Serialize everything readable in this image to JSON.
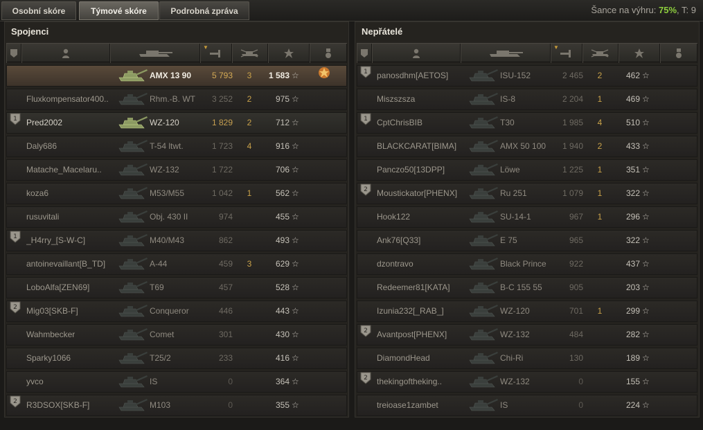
{
  "tabs": [
    {
      "label": "Osobní skóre"
    },
    {
      "label": "Týmové skóre"
    },
    {
      "label": "Podrobná zpráva"
    }
  ],
  "win_chance": {
    "label": "Šance na výhru:",
    "value": "75%",
    "tier": "T: 9"
  },
  "colors": {
    "accent_green": "#8ecf3e",
    "gold": "#c9a24a"
  },
  "allies": {
    "title": "Spojenci",
    "rows": [
      {
        "badge": "",
        "name": "",
        "vehicle": "AMX 13 90",
        "damage": "5 793",
        "kills": "3",
        "xp": "1 583",
        "award": "medal-icon",
        "style": "player"
      },
      {
        "badge": "",
        "name": "Fluxkompensator400..",
        "vehicle": "Rhm.-B. WT",
        "damage": "3 252",
        "kills": "2",
        "xp": "975",
        "award": "",
        "style": ""
      },
      {
        "badge": "platoon-1",
        "name": "Pred2002",
        "vehicle": "WZ-120",
        "damage": "1 829",
        "kills": "2",
        "xp": "712",
        "award": "",
        "style": "platoon"
      },
      {
        "badge": "",
        "name": "Daly686",
        "vehicle": "T-54 ltwt.",
        "damage": "1 723",
        "kills": "4",
        "xp": "916",
        "award": "",
        "style": ""
      },
      {
        "badge": "",
        "name": "Matache_Macelaru..",
        "vehicle": "WZ-132",
        "damage": "1 722",
        "kills": "",
        "xp": "706",
        "award": "",
        "style": ""
      },
      {
        "badge": "",
        "name": "koza6",
        "vehicle": "M53/M55",
        "damage": "1 042",
        "kills": "1",
        "xp": "562",
        "award": "",
        "style": ""
      },
      {
        "badge": "",
        "name": "rusuvitali",
        "vehicle": "Obj. 430 II",
        "damage": "974",
        "kills": "",
        "xp": "455",
        "award": "",
        "style": ""
      },
      {
        "badge": "platoon-1",
        "name": "_H4rry_[S-W-C]",
        "vehicle": "M40/M43",
        "damage": "862",
        "kills": "",
        "xp": "493",
        "award": "",
        "style": ""
      },
      {
        "badge": "",
        "name": "antoinevaillant[B_TD]",
        "vehicle": "A-44",
        "damage": "459",
        "kills": "3",
        "xp": "629",
        "award": "",
        "style": ""
      },
      {
        "badge": "",
        "name": "LoboAlfa[ZEN69]",
        "vehicle": "T69",
        "damage": "457",
        "kills": "",
        "xp": "528",
        "award": "",
        "style": ""
      },
      {
        "badge": "platoon-2",
        "name": "Mig03[SKB-F]",
        "vehicle": "Conqueror",
        "damage": "446",
        "kills": "",
        "xp": "443",
        "award": "",
        "style": ""
      },
      {
        "badge": "",
        "name": "Wahmbecker",
        "vehicle": "Comet",
        "damage": "301",
        "kills": "",
        "xp": "430",
        "award": "",
        "style": ""
      },
      {
        "badge": "",
        "name": "Sparky1066",
        "vehicle": "T25/2",
        "damage": "233",
        "kills": "",
        "xp": "416",
        "award": "",
        "style": ""
      },
      {
        "badge": "",
        "name": "yvco",
        "vehicle": "IS",
        "damage": "0",
        "kills": "",
        "xp": "364",
        "award": "",
        "style": "dim"
      },
      {
        "badge": "platoon-2",
        "name": "R3DSOX[SKB-F]",
        "vehicle": "M103",
        "damage": "0",
        "kills": "",
        "xp": "355",
        "award": "",
        "style": "dim"
      }
    ]
  },
  "enemies": {
    "title": "Nepřátelé",
    "rows": [
      {
        "badge": "platoon-1",
        "name": "panosdhm[AETOS]",
        "vehicle": "ISU-152",
        "damage": "2 465",
        "kills": "2",
        "xp": "462",
        "award": "",
        "style": ""
      },
      {
        "badge": "",
        "name": "Miszszsza",
        "vehicle": "IS-8",
        "damage": "2 204",
        "kills": "1",
        "xp": "469",
        "award": "",
        "style": ""
      },
      {
        "badge": "platoon-1",
        "name": "CptChrisBIB",
        "vehicle": "T30",
        "damage": "1 985",
        "kills": "4",
        "xp": "510",
        "award": "",
        "style": ""
      },
      {
        "badge": "",
        "name": "BLACKCARAT[BIMA]",
        "vehicle": "AMX 50 100",
        "damage": "1 940",
        "kills": "2",
        "xp": "433",
        "award": "",
        "style": ""
      },
      {
        "badge": "",
        "name": "Panczo50[13DPP]",
        "vehicle": "Löwe",
        "damage": "1 225",
        "kills": "1",
        "xp": "351",
        "award": "",
        "style": ""
      },
      {
        "badge": "platoon-2",
        "name": "Moustickator[PHENX]",
        "vehicle": "Ru 251",
        "damage": "1 079",
        "kills": "1",
        "xp": "322",
        "award": "",
        "style": ""
      },
      {
        "badge": "",
        "name": "Hook122",
        "vehicle": "SU-14-1",
        "damage": "967",
        "kills": "1",
        "xp": "296",
        "award": "",
        "style": ""
      },
      {
        "badge": "",
        "name": "Ank76[Q33]",
        "vehicle": "E 75",
        "damage": "965",
        "kills": "",
        "xp": "322",
        "award": "",
        "style": ""
      },
      {
        "badge": "",
        "name": "dzontravo",
        "vehicle": "Black Prince",
        "damage": "922",
        "kills": "",
        "xp": "437",
        "award": "",
        "style": ""
      },
      {
        "badge": "",
        "name": "Redeemer81[KATA]",
        "vehicle": "B-C 155 55",
        "damage": "905",
        "kills": "",
        "xp": "203",
        "award": "",
        "style": ""
      },
      {
        "badge": "",
        "name": "Izunia232[_RAB_]",
        "vehicle": "WZ-120",
        "damage": "701",
        "kills": "1",
        "xp": "299",
        "award": "",
        "style": ""
      },
      {
        "badge": "platoon-2",
        "name": "Avantpost[PHENX]",
        "vehicle": "WZ-132",
        "damage": "484",
        "kills": "",
        "xp": "282",
        "award": "",
        "style": ""
      },
      {
        "badge": "",
        "name": "DiamondHead",
        "vehicle": "Chi-Ri",
        "damage": "130",
        "kills": "",
        "xp": "189",
        "award": "",
        "style": ""
      },
      {
        "badge": "platoon-2",
        "name": "thekingoftheking..",
        "vehicle": "WZ-132",
        "damage": "0",
        "kills": "",
        "xp": "155",
        "award": "",
        "style": "dim"
      },
      {
        "badge": "",
        "name": "treioase1zambet",
        "vehicle": "IS",
        "damage": "0",
        "kills": "",
        "xp": "224",
        "award": "",
        "style": "dim"
      }
    ]
  }
}
